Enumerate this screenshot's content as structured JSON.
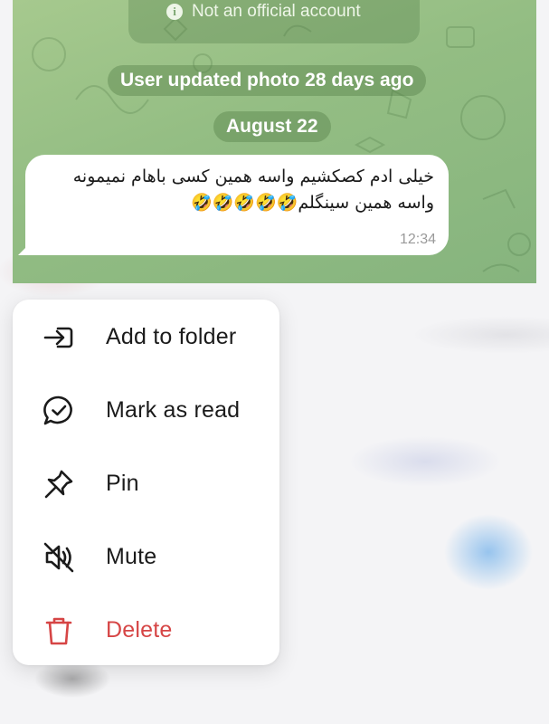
{
  "chat": {
    "notice": "Not an official account",
    "service_update": "User updated photo 28 days ago",
    "date_separator": "August 22",
    "message": {
      "text": "خیلی ادم کصکشیم واسه همین کسی باهام نمیمونه واسه همین سینگلم🤣🤣🤣🤣🤣",
      "time": "12:34"
    }
  },
  "context_menu": {
    "items": [
      {
        "label": "Add to folder",
        "icon": "folder-add-icon"
      },
      {
        "label": "Mark as read",
        "icon": "chat-check-icon"
      },
      {
        "label": "Pin",
        "icon": "pin-icon"
      },
      {
        "label": "Mute",
        "icon": "mute-icon"
      },
      {
        "label": "Delete",
        "icon": "trash-icon",
        "color": "#d64545"
      }
    ]
  },
  "colors": {
    "wallpaper": "#93bd83",
    "danger": "#d64545",
    "bubble": "#ffffff"
  }
}
